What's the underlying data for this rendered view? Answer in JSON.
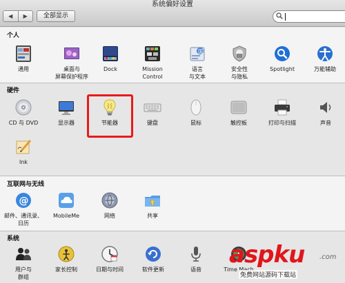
{
  "window": {
    "title": "系统偏好设置"
  },
  "toolbar": {
    "back": "◀",
    "forward": "▶",
    "show_all": "全部显示"
  },
  "search": {
    "value": ""
  },
  "sections": {
    "personal": {
      "label": "个人",
      "items": [
        {
          "label": "通用",
          "icon": "general-icon"
        },
        {
          "label": "桌面与\n屏幕保护程序",
          "icon": "desktop-screensaver-icon"
        },
        {
          "label": "Dock",
          "icon": "dock-icon"
        },
        {
          "label": "Mission\nControl",
          "icon": "mission-control-icon"
        },
        {
          "label": "语言\n与文本",
          "icon": "language-text-icon"
        },
        {
          "label": "安全性\n与隐私",
          "icon": "security-privacy-icon"
        },
        {
          "label": "Spotlight",
          "icon": "spotlight-icon"
        },
        {
          "label": "万能辅助",
          "icon": "accessibility-icon"
        }
      ]
    },
    "hardware": {
      "label": "硬件",
      "items": [
        {
          "label": "CD 与 DVD",
          "icon": "cd-dvd-icon"
        },
        {
          "label": "显示器",
          "icon": "display-icon"
        },
        {
          "label": "节能器",
          "icon": "energy-saver-icon"
        },
        {
          "label": "键盘",
          "icon": "keyboard-icon"
        },
        {
          "label": "鼠标",
          "icon": "mouse-icon"
        },
        {
          "label": "触控板",
          "icon": "trackpad-icon"
        },
        {
          "label": "打印与扫描",
          "icon": "print-scan-icon"
        },
        {
          "label": "声音",
          "icon": "sound-icon"
        },
        {
          "label": "Ink",
          "icon": "ink-icon"
        }
      ]
    },
    "internet": {
      "label": "互联网与无线",
      "items": [
        {
          "label": "邮件、通讯录、\n日历",
          "icon": "mail-contacts-calendar-icon"
        },
        {
          "label": "MobileMe",
          "icon": "mobileme-icon"
        },
        {
          "label": "网络",
          "icon": "network-icon"
        },
        {
          "label": "共享",
          "icon": "sharing-icon"
        }
      ]
    },
    "system": {
      "label": "系统",
      "items": [
        {
          "label": "用户与\n群组",
          "icon": "users-groups-icon"
        },
        {
          "label": "家长控制",
          "icon": "parental-controls-icon"
        },
        {
          "label": "日期与时间",
          "icon": "date-time-icon"
        },
        {
          "label": "软件更新",
          "icon": "software-update-icon"
        },
        {
          "label": "语音",
          "icon": "speech-icon"
        },
        {
          "label": "Time Mach",
          "icon": "time-machine-icon"
        }
      ]
    }
  },
  "watermark": {
    "brand": "aspku",
    "dot": ".com",
    "sub": "免费网站源码下载站"
  },
  "colors": {
    "highlight": "#e8191b",
    "brand": "#e0161b"
  }
}
